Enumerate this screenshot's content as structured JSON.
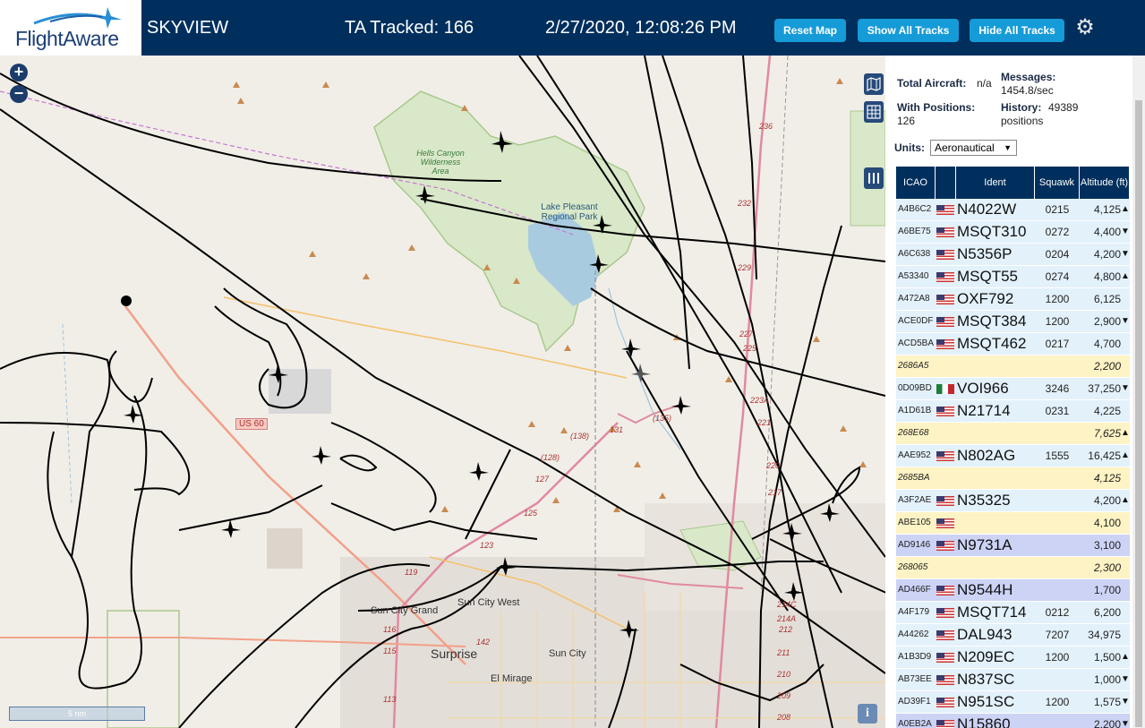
{
  "header": {
    "logo_text": "FlightAware",
    "app_name": "SKYVIEW",
    "ta_tracked": "TA Tracked: 166",
    "datetime": "2/27/2020, 12:08:26 PM",
    "reset_map": "Reset Map",
    "show_all_tracks": "Show All Tracks",
    "hide_all_tracks": "Hide All Tracks",
    "settings_icon": "gear-icon",
    "bg_color": "#002f5d",
    "button_color": "#169bd9"
  },
  "map": {
    "zoom_in": "+",
    "zoom_out": "−",
    "scale_label": "5 nm",
    "info": "i",
    "labels": {
      "hells_canyon": "Hells Canyon Wilderness Area",
      "lake_pleasant": "Lake Pleasant Regional Park",
      "sun_city_grand": "Sun City Grand",
      "sun_city_west": "Sun City West",
      "surprise": "Surprise",
      "sun_city": "Sun City",
      "el_mirage": "El Mirage",
      "us60": "US 60",
      "r135": "(135)",
      "r131": "131",
      "r138": "(138)",
      "r128": "(128)",
      "r127": "127",
      "r125": "125",
      "r123": "123",
      "r119": "119",
      "r116": "116",
      "r115": "115",
      "r113": "113",
      "r142": "142",
      "r236": "236",
      "r232": "232",
      "r229": "229",
      "r227": "227",
      "r225": "225",
      "r223a": "223A",
      "r221": "221",
      "r220": "220",
      "r217": "217",
      "r214c": "214C",
      "r214a": "214A",
      "r212": "212",
      "r211": "211",
      "r210": "210",
      "r209": "209",
      "r208": "208"
    }
  },
  "panel": {
    "total_aircraft_label": "Total Aircraft:",
    "total_aircraft_value": "n/a",
    "messages_label": "Messages:",
    "messages_value": "1454.8/sec",
    "with_positions_label": "With Positions:",
    "with_positions_value": "126",
    "history_label": "History:",
    "history_value": "49389",
    "history_unit": "positions",
    "units_label": "Units:",
    "units_value": "Aeronautical",
    "columns": [
      "ICAO",
      "Ident",
      "Squawk",
      "Altitude (ft)"
    ],
    "rows": [
      {
        "icao": "A4B6C2",
        "flag": "us",
        "ident": "N4022W",
        "squawk": "0215",
        "alt": "4,125",
        "trend": "▲",
        "bg": "#e3f1fb"
      },
      {
        "icao": "A6BE75",
        "flag": "us",
        "ident": "MSQT310",
        "squawk": "0272",
        "alt": "4,400",
        "trend": "▼",
        "bg": "#e3f1fb"
      },
      {
        "icao": "A6C638",
        "flag": "us",
        "ident": "N5356P",
        "squawk": "0204",
        "alt": "4,200",
        "trend": "▼",
        "bg": "#e3f1fb"
      },
      {
        "icao": "A53340",
        "flag": "us",
        "ident": "MSQT55",
        "squawk": "0274",
        "alt": "4,800",
        "trend": "▲",
        "bg": "#e3f1fb"
      },
      {
        "icao": "A472A8",
        "flag": "us",
        "ident": "OXF792",
        "squawk": "1200",
        "alt": "6,125",
        "trend": "",
        "bg": "#e3f1fb"
      },
      {
        "icao": "ACE0DF",
        "flag": "us",
        "ident": "MSQT384",
        "squawk": "1200",
        "alt": "2,900",
        "trend": "▼",
        "bg": "#e3f1fb"
      },
      {
        "icao": "ACD5BA",
        "flag": "us",
        "ident": "MSQT462",
        "squawk": "0217",
        "alt": "4,700",
        "trend": "",
        "bg": "#e3f1fb"
      },
      {
        "icao": "2686A5",
        "flag": "",
        "ident": "",
        "squawk": "",
        "alt": "2,200",
        "trend": "",
        "bg": "#fdf3c4",
        "italic": true
      },
      {
        "icao": "0D09BD",
        "flag": "mx",
        "ident": "VOI966",
        "squawk": "3246",
        "alt": "37,250",
        "trend": "▼",
        "bg": "#e3f1fb"
      },
      {
        "icao": "A1D61B",
        "flag": "us",
        "ident": "N21714",
        "squawk": "0231",
        "alt": "4,225",
        "trend": "",
        "bg": "#e3f1fb"
      },
      {
        "icao": "268E68",
        "flag": "",
        "ident": "",
        "squawk": "",
        "alt": "7,625",
        "trend": "▲",
        "bg": "#fdf3c4",
        "italic": true
      },
      {
        "icao": "AAE952",
        "flag": "us",
        "ident": "N802AG",
        "squawk": "1555",
        "alt": "16,425",
        "trend": "▲",
        "bg": "#e3f1fb"
      },
      {
        "icao": "2685BA",
        "flag": "",
        "ident": "",
        "squawk": "",
        "alt": "4,125",
        "trend": "",
        "bg": "#fdf3c4",
        "italic": true
      },
      {
        "icao": "A3F2AE",
        "flag": "us",
        "ident": "N35325",
        "squawk": "",
        "alt": "4,200",
        "trend": "▲",
        "bg": "#e3f1fb"
      },
      {
        "icao": "ABE105",
        "flag": "us",
        "ident": "",
        "squawk": "",
        "alt": "4,100",
        "trend": "",
        "bg": "#fdf3c4"
      },
      {
        "icao": "AD9146",
        "flag": "us",
        "ident": "N9731A",
        "squawk": "",
        "alt": "3,100",
        "trend": "",
        "bg": "#ccd3f5"
      },
      {
        "icao": "268065",
        "flag": "",
        "ident": "",
        "squawk": "",
        "alt": "2,300",
        "trend": "",
        "bg": "#fdf3c4",
        "italic": true
      },
      {
        "icao": "AD466F",
        "flag": "us",
        "ident": "N9544H",
        "squawk": "",
        "alt": "1,700",
        "trend": "",
        "bg": "#ccd3f5"
      },
      {
        "icao": "A4F179",
        "flag": "us",
        "ident": "MSQT714",
        "squawk": "0212",
        "alt": "6,200",
        "trend": "",
        "bg": "#e3f1fb"
      },
      {
        "icao": "A44262",
        "flag": "us",
        "ident": "DAL943",
        "squawk": "7207",
        "alt": "34,975",
        "trend": "",
        "bg": "#e3f1fb"
      },
      {
        "icao": "A1B3D9",
        "flag": "us",
        "ident": "N209EC",
        "squawk": "1200",
        "alt": "1,500",
        "trend": "▲",
        "bg": "#e3f1fb"
      },
      {
        "icao": "AB73EE",
        "flag": "us",
        "ident": "N837SC",
        "squawk": "",
        "alt": "1,000",
        "trend": "▼",
        "bg": "#e3f1fb"
      },
      {
        "icao": "AD39F1",
        "flag": "us",
        "ident": "N951SC",
        "squawk": "1200",
        "alt": "1,575",
        "trend": "▼",
        "bg": "#e3f1fb"
      },
      {
        "icao": "A0EB2A",
        "flag": "us",
        "ident": "N15860",
        "squawk": "",
        "alt": "2,200",
        "trend": "▼",
        "bg": "#ccd3f5"
      }
    ]
  }
}
